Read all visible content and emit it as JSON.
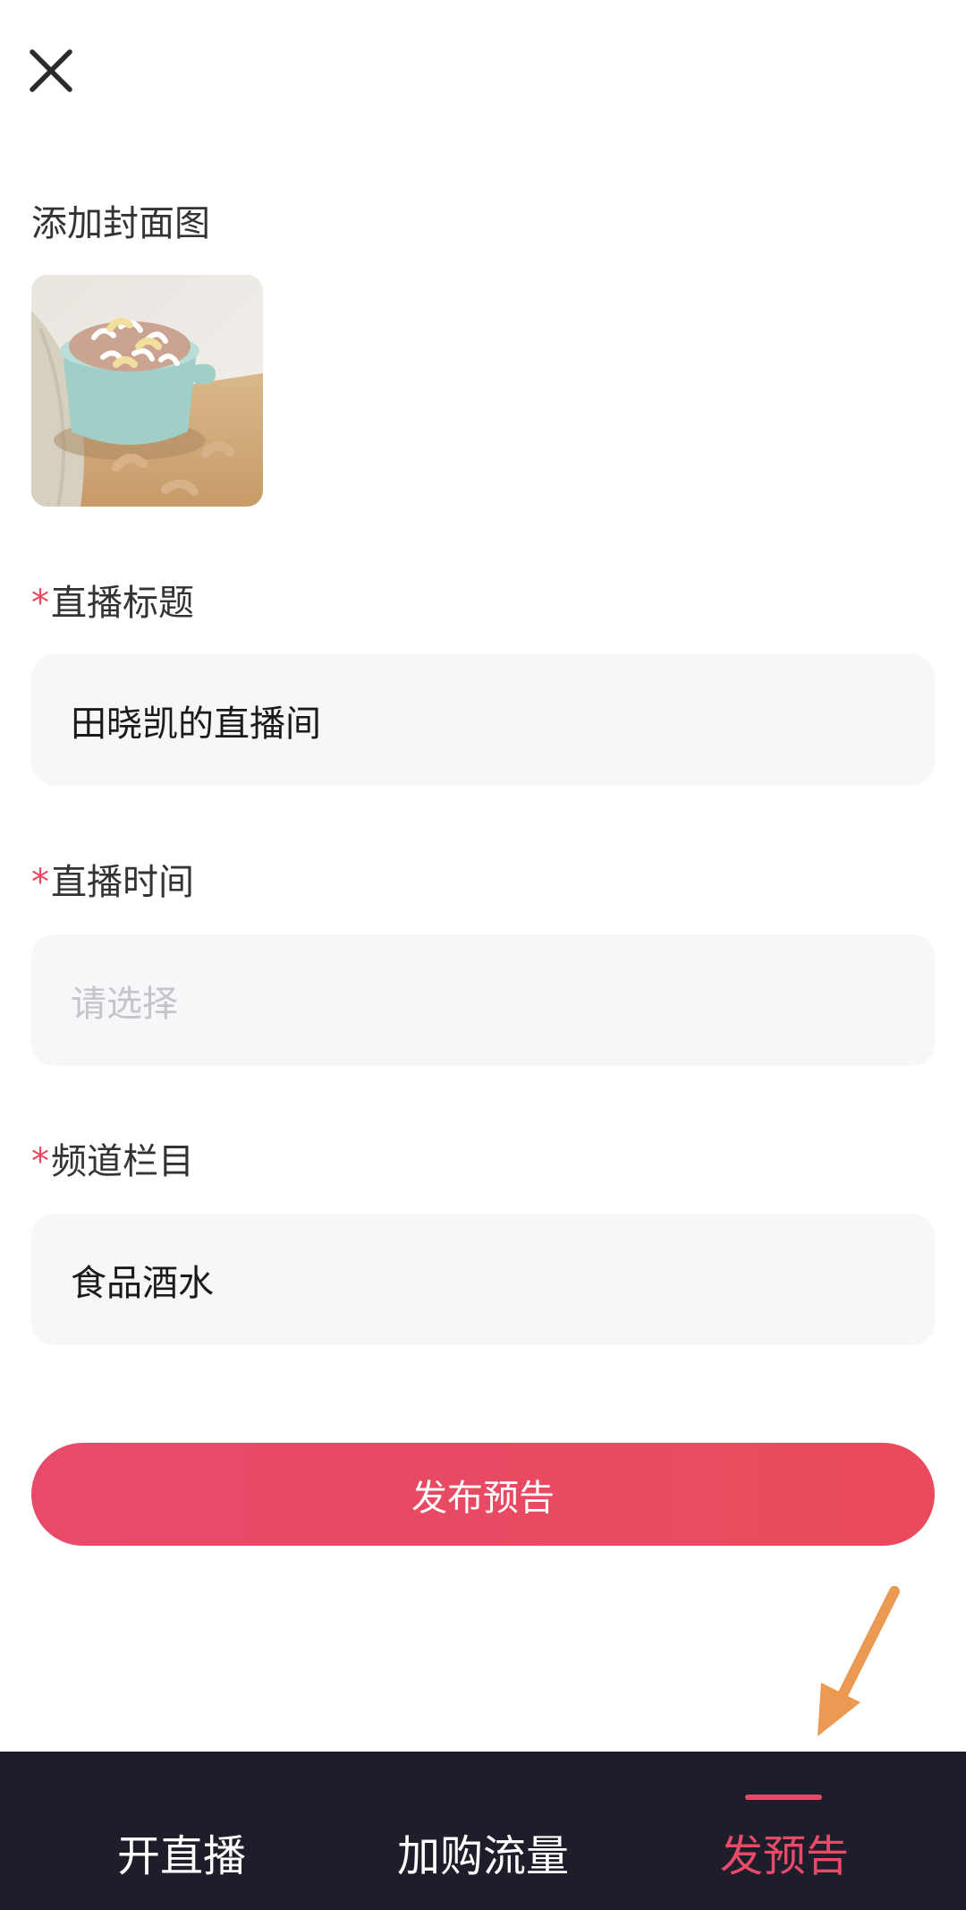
{
  "header": {
    "close_icon": "close-icon"
  },
  "cover": {
    "label": "添加封面图",
    "image": "cashew-bowl-photo"
  },
  "title_field": {
    "required_mark": "*",
    "label": "直播标题",
    "value": "田晓凯的直播间"
  },
  "time_field": {
    "required_mark": "*",
    "label": "直播时间",
    "placeholder": "请选择"
  },
  "channel_field": {
    "required_mark": "*",
    "label": "频道栏目",
    "value": "食品酒水"
  },
  "publish_button": {
    "label": "发布预告"
  },
  "bottom_nav": {
    "tabs": [
      {
        "label": "开直播",
        "active": false
      },
      {
        "label": "加购流量",
        "active": false
      },
      {
        "label": "发预告",
        "active": true
      }
    ]
  },
  "colors": {
    "accent": "#e84a6a",
    "nav_bg": "#1d1e29",
    "field_bg": "#f6f7f9",
    "annotation_arrow": "#ec9a52"
  }
}
